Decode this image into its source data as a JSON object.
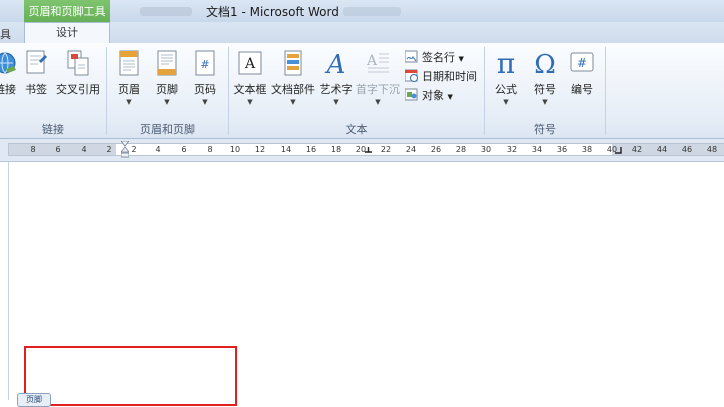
{
  "window": {
    "title": "文档1 - Microsoft Word"
  },
  "context_tab": {
    "title": "页眉和页脚工具",
    "tab": "设计"
  },
  "tabs": {
    "left_partial": "具"
  },
  "ribbon": {
    "groups": [
      {
        "label": "链接",
        "buttons": [
          "链接",
          "书签",
          "交叉引用"
        ]
      },
      {
        "label": "页眉和页脚",
        "buttons": [
          "页眉",
          "页脚",
          "页码"
        ]
      },
      {
        "label": "文本",
        "buttons": [
          "文本框",
          "文档部件",
          "艺术字",
          "首字下沉"
        ],
        "small_buttons": [
          "签名行",
          "日期和时间",
          "对象"
        ]
      },
      {
        "label": "符号",
        "buttons": [
          "公式",
          "符号",
          "编号"
        ]
      }
    ],
    "icons": {
      "公式": "π",
      "符号": "Ω",
      "编号": "#",
      "艺术字": "A",
      "文本框": "A"
    }
  },
  "ruler": {
    "labels": [
      "8",
      "6",
      "4",
      "2",
      "2",
      "4",
      "6",
      "8",
      "10",
      "12",
      "14",
      "16",
      "18",
      "20",
      "22",
      "24",
      "26",
      "28",
      "30",
      "32",
      "34",
      "36",
      "38",
      "40",
      "42",
      "44",
      "46",
      "48"
    ]
  },
  "document": {
    "footer_tag": "页脚"
  },
  "colors": {
    "context_green": "#5aa64a",
    "highlight_red": "#e21f1f",
    "ribbon_bg": "#e7eef7"
  }
}
